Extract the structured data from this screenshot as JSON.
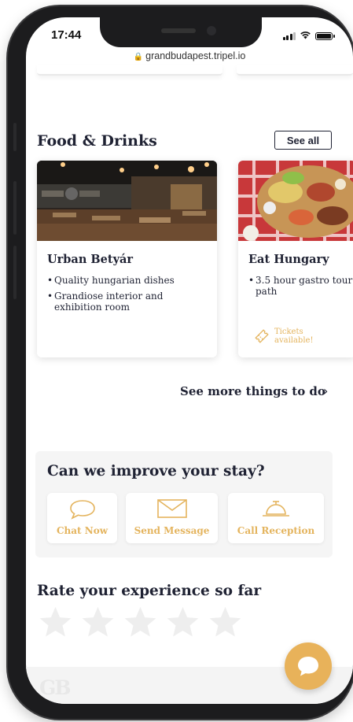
{
  "status_bar": {
    "time": "17:44"
  },
  "browser": {
    "url": "grandbudapest.tripel.io"
  },
  "food_section": {
    "title": "Food & Drinks",
    "see_all": "See all",
    "cards": [
      {
        "title": "Urban Betyár",
        "bullets": [
          "Quality hungarian dishes",
          "Grandiose interior and exhibition room"
        ]
      },
      {
        "title": "Eat Hungary",
        "bullets": [
          "3.5 hour gastro tour path"
        ],
        "badge": "Tickets available!"
      }
    ]
  },
  "see_more": "See more things to do",
  "improve": {
    "title": "Can we improve your stay?",
    "actions": [
      {
        "label": "Chat Now",
        "icon": "chat-bubble-icon"
      },
      {
        "label": "Send Message",
        "icon": "envelope-icon"
      },
      {
        "label": "Call Reception",
        "icon": "reception-bell-icon"
      }
    ]
  },
  "rating": {
    "title": "Rate your experience so far",
    "max_stars": 5,
    "value": 0
  },
  "footer": {
    "logo": "GB"
  },
  "colors": {
    "accent": "#e8b25a",
    "text": "#1f2233",
    "star_inactive": "#eeeeee"
  }
}
